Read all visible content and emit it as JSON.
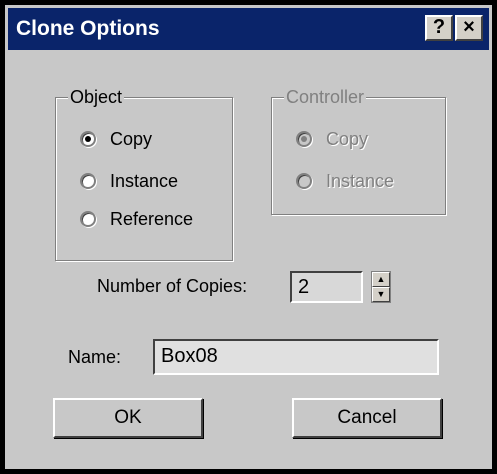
{
  "window": {
    "title": "Clone Options",
    "help_button": "?",
    "close_button": "×"
  },
  "object_group": {
    "label": "Object",
    "selected": "Copy",
    "options": [
      {
        "label": "Copy",
        "checked": true
      },
      {
        "label": "Instance",
        "checked": false
      },
      {
        "label": "Reference",
        "checked": false
      }
    ]
  },
  "controller_group": {
    "label": "Controller",
    "enabled": false,
    "options": [
      {
        "label": "Copy",
        "checked": true
      },
      {
        "label": "Instance",
        "checked": false
      }
    ]
  },
  "copies": {
    "label": "Number of Copies:",
    "value": "2"
  },
  "name": {
    "label": "Name:",
    "value": "Box08"
  },
  "buttons": {
    "ok": "OK",
    "cancel": "Cancel"
  }
}
